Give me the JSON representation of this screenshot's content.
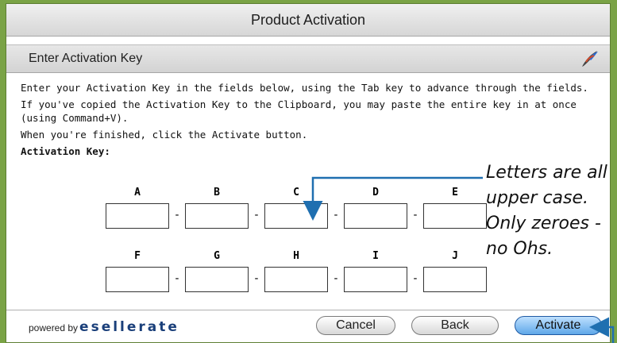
{
  "window": {
    "title": "Product Activation"
  },
  "header": {
    "title": "Enter Activation Key"
  },
  "content": {
    "instruction1": "Enter your Activation Key in the fields below, using the Tab key to advance through the fields.",
    "instruction2": "If you've copied the Activation Key to the Clipboard, you may paste the entire key in at once (using Command+V).",
    "instruction3": "When you're finished, click the Activate button.",
    "key_label": "Activation Key:"
  },
  "fields": {
    "row1": [
      "A",
      "B",
      "C",
      "D",
      "E"
    ],
    "row2": [
      "F",
      "G",
      "H",
      "I",
      "J"
    ],
    "separator": "-"
  },
  "annotation": {
    "text": "Letters are all upper case. Only zeroes - no Ohs."
  },
  "footer": {
    "powered_by": "powered by",
    "brand": "esellerate",
    "cancel_label": "Cancel",
    "back_label": "Back",
    "activate_label": "Activate"
  },
  "colors": {
    "background": "#7aa346",
    "annotation_arrow": "#1f6fb0",
    "default_button": "#5fa7e8"
  }
}
